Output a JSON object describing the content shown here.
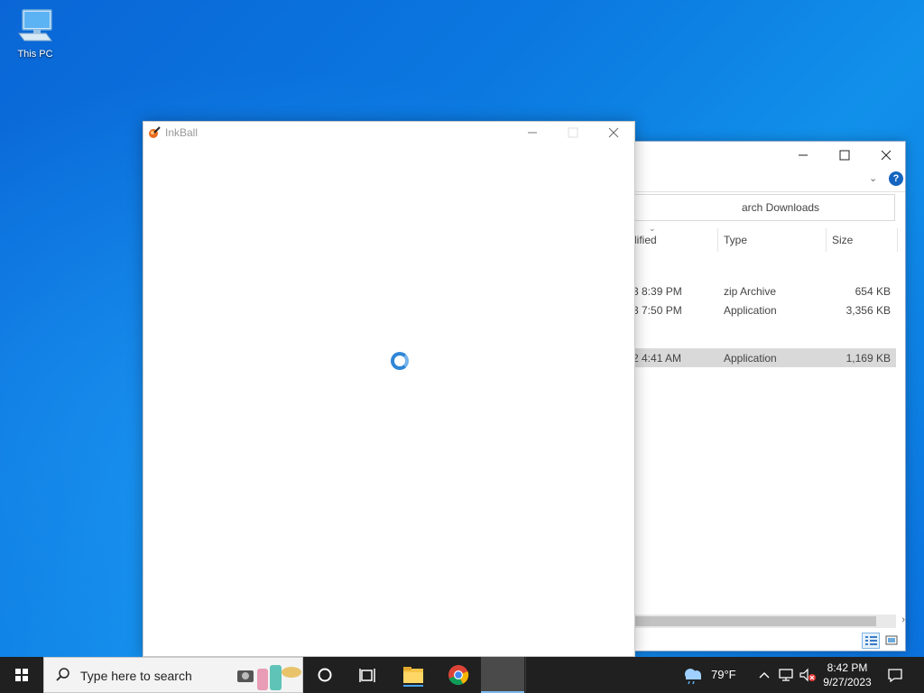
{
  "desktop": {
    "icons": [
      {
        "label": "This PC",
        "icon": "computer-icon"
      }
    ]
  },
  "explorer": {
    "search_placeholder": "arch Downloads",
    "columns": [
      "dified",
      "Type",
      "Size"
    ],
    "rows": [
      {
        "modified": "3 8:39 PM",
        "type": "zip Archive",
        "size": "654 KB",
        "selected": false
      },
      {
        "modified": "3 7:50 PM",
        "type": "Application",
        "size": "3,356 KB",
        "selected": false
      },
      {
        "modified": "2 4:41 AM",
        "type": "Application",
        "size": "1,169 KB",
        "selected": true
      }
    ],
    "help_label": "?"
  },
  "inkball": {
    "title": "InkBall"
  },
  "taskbar": {
    "search_placeholder": "Type here to search",
    "weather": "79°F",
    "time": "8:42 PM",
    "date": "9/27/2023",
    "colors": {
      "background": "#202020",
      "accent": "#7fb8ef"
    }
  }
}
